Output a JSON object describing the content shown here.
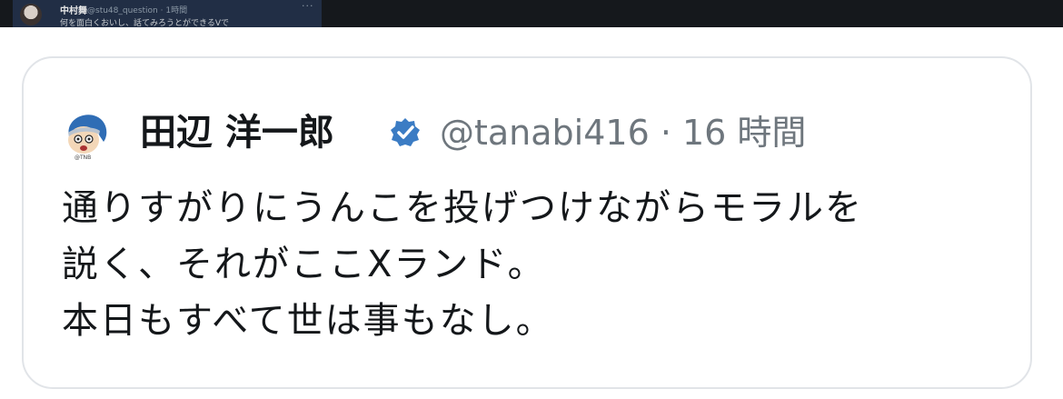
{
  "prev_tweet": {
    "author_name": "中村舞",
    "author_handle_time": "@stu48_question · 1時間",
    "more_label": "···",
    "text_preview": "何を面白くおいし、話てみろうとができるVで"
  },
  "quoted_tweet": {
    "author_name": "田辺 洋一郎",
    "handle_time": "@tanabi416 · 16 時間",
    "body_lines": [
      "通りすがりにうんこを投げつけながらモラルを",
      "説く、それがここXランド。",
      "本日もすべて世は事もなし。"
    ]
  },
  "colors": {
    "verified_badge": "#3b7cc4",
    "card_border": "#e1e4e8",
    "top_strip": "#15181c"
  },
  "icons": [
    "cartoon-avatar-icon",
    "verified-badge-icon",
    "user-avatar-icon"
  ]
}
